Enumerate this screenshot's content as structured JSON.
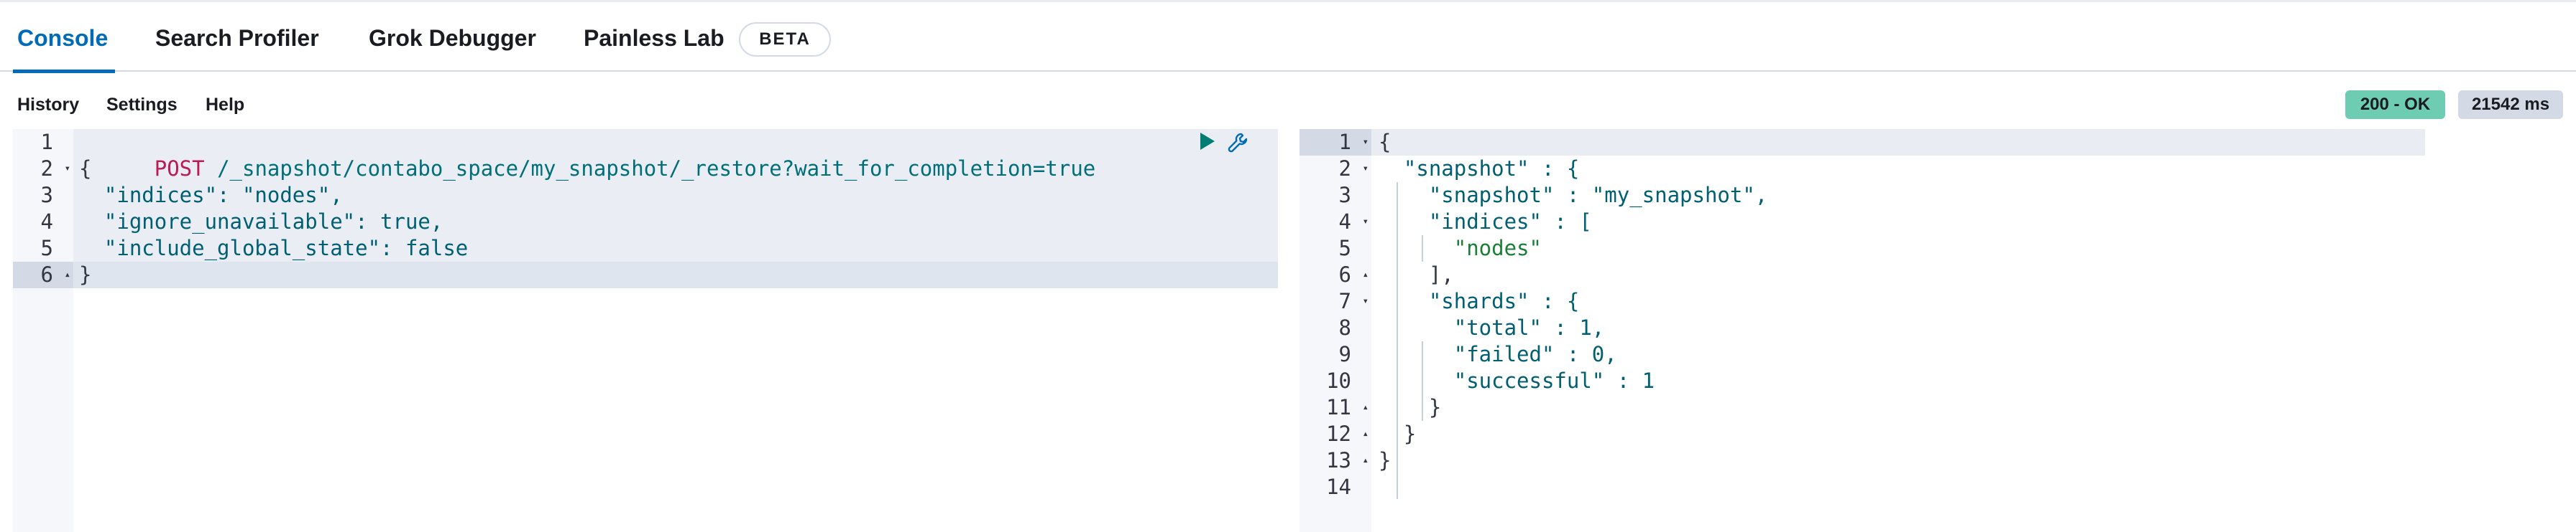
{
  "tabs": [
    {
      "label": "Console",
      "active": true
    },
    {
      "label": "Search Profiler",
      "active": false
    },
    {
      "label": "Grok Debugger",
      "active": false
    },
    {
      "label": "Painless Lab",
      "active": false
    }
  ],
  "beta_badge": "BETA",
  "toolbar": {
    "history": "History",
    "settings": "Settings",
    "help": "Help"
  },
  "status": {
    "ok": "200 - OK",
    "time": "21542 ms"
  },
  "request": {
    "method": "POST",
    "path": " /_snapshot/contabo_space/my_snapshot/_restore?wait_for_completion=true",
    "lines": [
      "{",
      "  \"indices\": \"nodes\",",
      "  \"ignore_unavailable\": true,",
      "  \"include_global_state\": false",
      "}"
    ],
    "line_numbers": [
      "1",
      "2",
      "3",
      "4",
      "5",
      "6"
    ]
  },
  "response": {
    "lines": [
      "{",
      "  \"snapshot\" : {",
      "    \"snapshot\" : \"my_snapshot\",",
      "    \"indices\" : [",
      "      \"nodes\"",
      "    ],",
      "    \"shards\" : {",
      "      \"total\" : 1,",
      "      \"failed\" : 0,",
      "      \"successful\" : 1",
      "    }",
      "  }",
      "}",
      ""
    ],
    "line_numbers": [
      "1",
      "2",
      "3",
      "4",
      "5",
      "6",
      "7",
      "8",
      "9",
      "10",
      "11",
      "12",
      "13",
      "14"
    ]
  },
  "icons": {
    "run": "play-icon",
    "wrench": "wrench-icon"
  }
}
